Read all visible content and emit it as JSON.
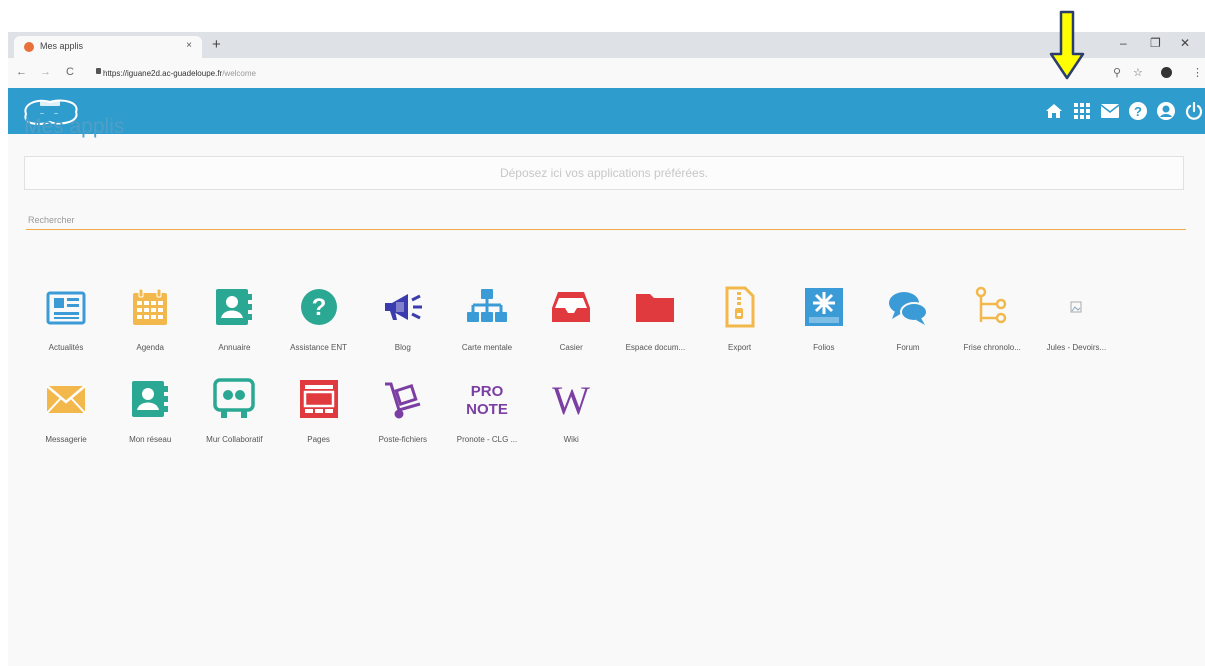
{
  "browser": {
    "tab_title": "Mes applis",
    "tab_close": "×",
    "new_tab": "+",
    "win_min": "–",
    "win_restore": "❐",
    "win_close": "✕",
    "nav_back": "←",
    "nav_forward": "→",
    "nav_reload": "C",
    "url_host": "https://iguane2d.ac-guadeloupe.fr",
    "url_path": "/welcome",
    "zoom_icon": "⚲",
    "star_icon": "☆",
    "menu_icon": "⋮"
  },
  "header": {
    "brand_color": "#2e9ccc",
    "icons": [
      "home-icon",
      "apps-grid-icon",
      "mail-icon",
      "help-icon",
      "user-icon",
      "power-icon"
    ]
  },
  "page": {
    "title": "Mes applis",
    "dropzone_text": "Déposez ici vos applications préférées.",
    "search_placeholder": "Rechercher"
  },
  "apps": [
    {
      "label": "Actualités",
      "icon": "newspaper-icon",
      "color": "#3a9bd6"
    },
    {
      "label": "Agenda",
      "icon": "calendar-icon",
      "color": "#f2b84b"
    },
    {
      "label": "Annuaire",
      "icon": "contact-book-icon",
      "color": "#2aa893"
    },
    {
      "label": "Assistance ENT",
      "icon": "question-icon",
      "color": "#2aa893"
    },
    {
      "label": "Blog",
      "icon": "megaphone-icon",
      "color": "#3b3bb0"
    },
    {
      "label": "Carte mentale",
      "icon": "sitemap-icon",
      "color": "#3a9bd6"
    },
    {
      "label": "Casier",
      "icon": "inbox-icon",
      "color": "#e0393e"
    },
    {
      "label": "Espace docum...",
      "icon": "folder-icon",
      "color": "#e0393e"
    },
    {
      "label": "Export",
      "icon": "zip-file-icon",
      "color": "#f2b84b"
    },
    {
      "label": "Folios",
      "icon": "folios-icon",
      "color": "#3a9bd6"
    },
    {
      "label": "Forum",
      "icon": "chat-bubbles-icon",
      "color": "#3a9bd6"
    },
    {
      "label": "Frise chronolo...",
      "icon": "timeline-icon",
      "color": "#f2b84b"
    },
    {
      "label": "Jules - Devoirs...",
      "icon": "broken-image-icon",
      "color": "#bbbbbb"
    },
    {
      "label": "Messagerie",
      "icon": "envelope-icon",
      "color": "#f2b84b"
    },
    {
      "label": "Mon réseau",
      "icon": "network-book-icon",
      "color": "#2aa893"
    },
    {
      "label": "Mur Collaboratif",
      "icon": "collab-wall-icon",
      "color": "#2aa893"
    },
    {
      "label": "Pages",
      "icon": "pages-icon",
      "color": "#e0393e"
    },
    {
      "label": "Poste-fichiers",
      "icon": "file-trolley-icon",
      "color": "#7b3fa3"
    },
    {
      "label": "Pronote - CLG ...",
      "icon": "pronote-logo-icon",
      "color": "#7b3fa3"
    },
    {
      "label": "Wiki",
      "icon": "wikipedia-icon",
      "color": "#7b3fa3"
    }
  ],
  "annotation": {
    "arrow_color": "#ffff00",
    "arrow_target": "apps-grid-icon"
  }
}
